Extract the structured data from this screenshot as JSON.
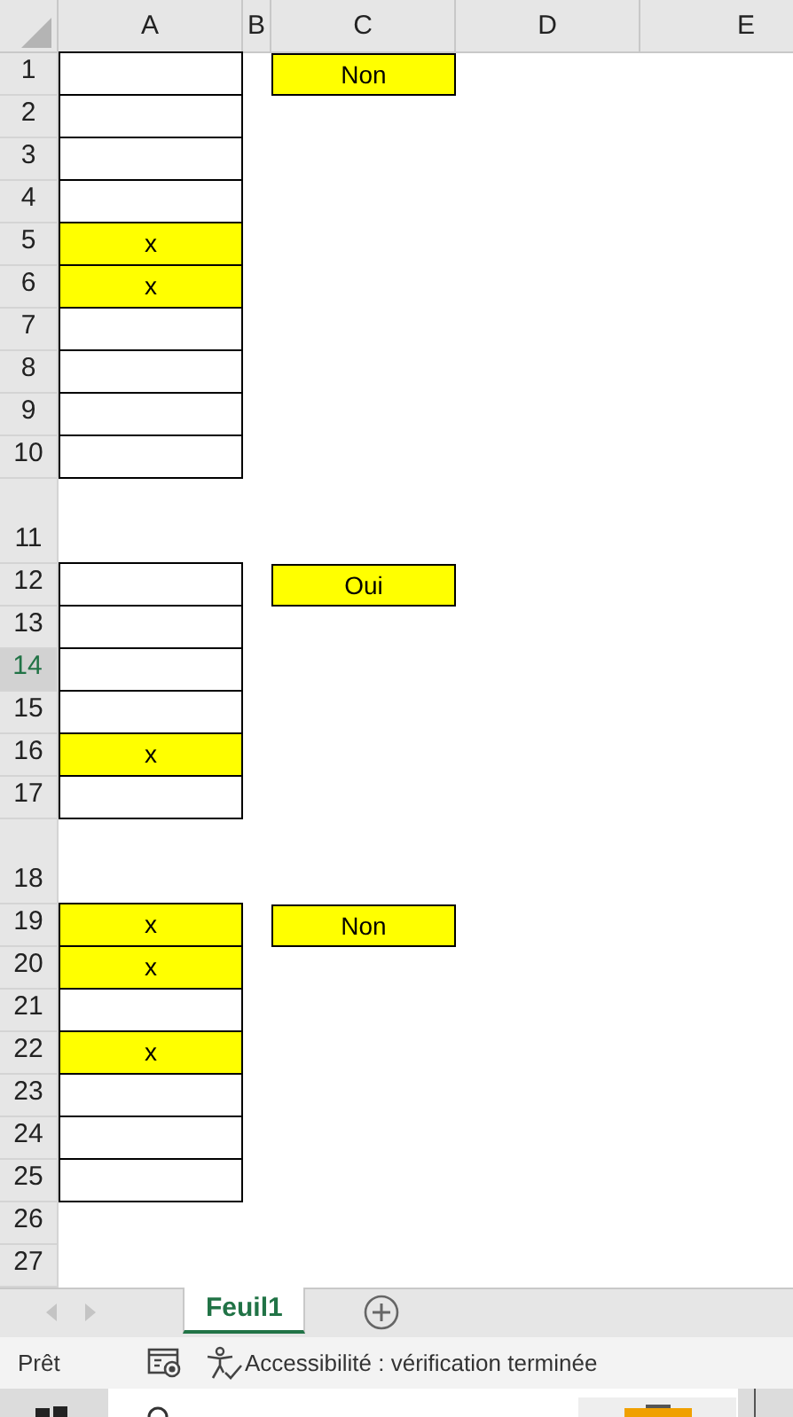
{
  "columns": [
    "A",
    "B",
    "C",
    "D",
    "E"
  ],
  "rows": [
    {
      "number": "1",
      "kind": "normal",
      "selected": false,
      "a": {
        "kind": "boxed",
        "highlighted": false
      },
      "c": {
        "text": "Non",
        "highlighted": true
      }
    },
    {
      "number": "2",
      "kind": "normal",
      "selected": false,
      "a": {
        "kind": "boxed",
        "highlighted": false
      }
    },
    {
      "number": "3",
      "kind": "normal",
      "selected": false,
      "a": {
        "kind": "boxed",
        "highlighted": false
      }
    },
    {
      "number": "4",
      "kind": "normal",
      "selected": false,
      "a": {
        "kind": "boxed",
        "highlighted": false
      }
    },
    {
      "number": "5",
      "kind": "normal",
      "selected": false,
      "a": {
        "kind": "boxed",
        "highlighted": true,
        "text": "x"
      }
    },
    {
      "number": "6",
      "kind": "normal",
      "selected": false,
      "a": {
        "kind": "boxed",
        "highlighted": true,
        "text": "x"
      }
    },
    {
      "number": "7",
      "kind": "normal",
      "selected": false,
      "a": {
        "kind": "boxed",
        "highlighted": false
      }
    },
    {
      "number": "8",
      "kind": "normal",
      "selected": false,
      "a": {
        "kind": "boxed",
        "highlighted": false
      }
    },
    {
      "number": "9",
      "kind": "normal",
      "selected": false,
      "a": {
        "kind": "boxed",
        "highlighted": false
      }
    },
    {
      "number": "10",
      "kind": "normal",
      "selected": false,
      "a": {
        "kind": "boxed",
        "highlighted": false
      }
    },
    {
      "number": "11",
      "kind": "tall",
      "selected": false
    },
    {
      "number": "12",
      "kind": "normal",
      "selected": false,
      "a": {
        "kind": "boxed",
        "highlighted": false
      },
      "c": {
        "text": "Oui",
        "highlighted": true
      }
    },
    {
      "number": "13",
      "kind": "normal",
      "selected": false,
      "a": {
        "kind": "boxed",
        "highlighted": false
      }
    },
    {
      "number": "14",
      "kind": "normal",
      "selected": true,
      "a": {
        "kind": "boxed",
        "highlighted": false
      }
    },
    {
      "number": "15",
      "kind": "normal",
      "selected": false,
      "a": {
        "kind": "boxed",
        "highlighted": false
      }
    },
    {
      "number": "16",
      "kind": "normal",
      "selected": false,
      "a": {
        "kind": "boxed",
        "highlighted": true,
        "text": "x"
      }
    },
    {
      "number": "17",
      "kind": "normal",
      "selected": false,
      "a": {
        "kind": "boxed",
        "highlighted": false
      }
    },
    {
      "number": "18",
      "kind": "tall",
      "selected": false
    },
    {
      "number": "19",
      "kind": "normal",
      "selected": false,
      "a": {
        "kind": "boxed",
        "highlighted": true,
        "text": "x"
      },
      "c": {
        "text": "Non",
        "highlighted": true
      }
    },
    {
      "number": "20",
      "kind": "normal",
      "selected": false,
      "a": {
        "kind": "boxed",
        "highlighted": true,
        "text": "x"
      }
    },
    {
      "number": "21",
      "kind": "normal",
      "selected": false,
      "a": {
        "kind": "boxed",
        "highlighted": false
      }
    },
    {
      "number": "22",
      "kind": "normal",
      "selected": false,
      "a": {
        "kind": "boxed",
        "highlighted": true,
        "text": "x"
      }
    },
    {
      "number": "23",
      "kind": "normal",
      "selected": false,
      "a": {
        "kind": "boxed",
        "highlighted": false
      }
    },
    {
      "number": "24",
      "kind": "normal",
      "selected": false,
      "a": {
        "kind": "boxed",
        "highlighted": false
      }
    },
    {
      "number": "25",
      "kind": "normal",
      "selected": false,
      "a": {
        "kind": "boxed",
        "highlighted": false
      }
    },
    {
      "number": "26",
      "kind": "normal",
      "selected": false
    },
    {
      "number": "27",
      "kind": "normal",
      "selected": false
    }
  ],
  "sheet_tabs": [
    {
      "label": "Feuil1",
      "selected": true
    }
  ],
  "status_bar": {
    "mode": "Prêt",
    "accessibility": "Accessibilité : vérification terminée"
  }
}
